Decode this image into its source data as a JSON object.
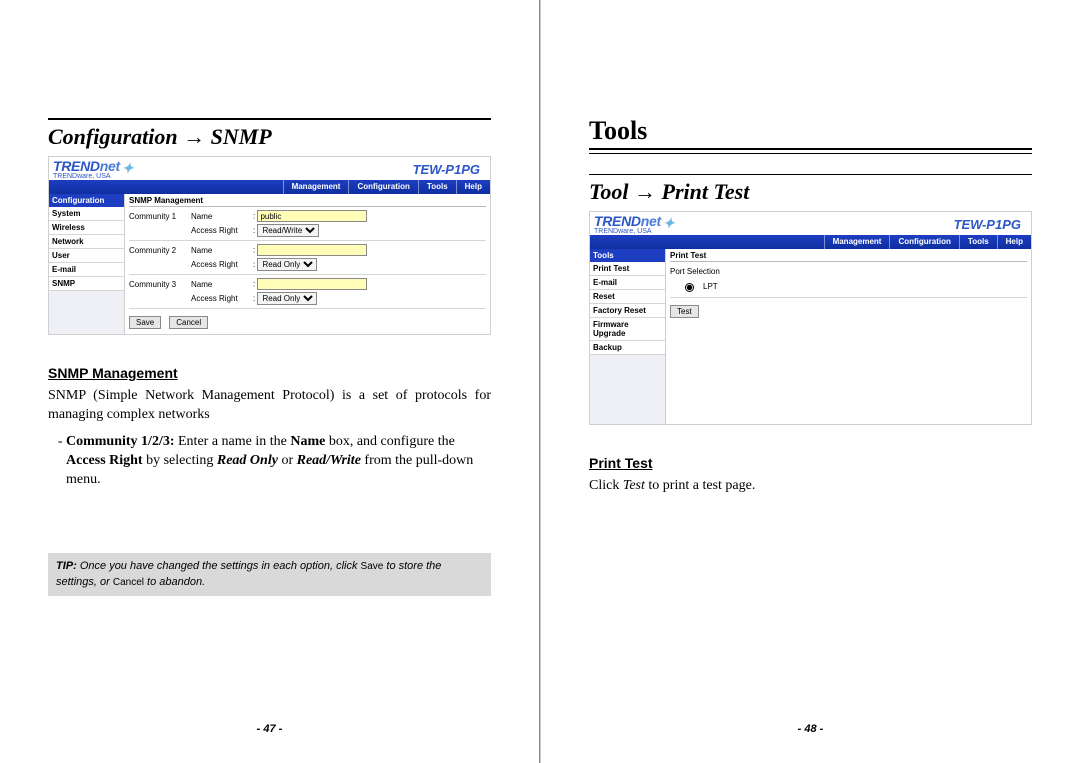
{
  "left": {
    "breadcrumb_prefix": "Configuration",
    "breadcrumb_arrow": " → ",
    "breadcrumb_target": "SNMP",
    "model": "TEW-P1PG",
    "brand_main": "TREND",
    "brand_suffix": "net",
    "brand_tagline": "TRENDware, USA",
    "nav": [
      "Management",
      "Configuration",
      "Tools",
      "Help"
    ],
    "sidebar_header": "Configuration",
    "sidebar_items": [
      "System",
      "Wireless",
      "Network",
      "User",
      "E-mail",
      "SNMP"
    ],
    "panel_title": "SNMP Management",
    "rows": [
      {
        "group": "Community 1",
        "name_label": "Name",
        "name_value": "public",
        "right_label": "Access Right",
        "right_value": "Read/Write"
      },
      {
        "group": "Community 2",
        "name_label": "Name",
        "name_value": "",
        "right_label": "Access Right",
        "right_value": "Read Only"
      },
      {
        "group": "Community 3",
        "name_label": "Name",
        "name_value": "",
        "right_label": "Access Right",
        "right_value": "Read Only"
      }
    ],
    "save_label": "Save",
    "cancel_label": "Cancel",
    "section_heading": "SNMP Management",
    "section_body": "SNMP (Simple Network Management Protocol) is a set of protocols for managing complex networks",
    "bullet_lead_bold": "Community 1/2/3: ",
    "bullet_text_1": "Enter a name in the ",
    "bullet_bold_name": "Name",
    "bullet_text_2": " box, and configure the ",
    "bullet_bold_access": "Access Right",
    "bullet_text_3": " by selecting ",
    "bullet_bi_ro": "Read Only",
    "bullet_text_4": " or ",
    "bullet_bi_rw": "Read/Write",
    "bullet_text_5": " from the pull-down menu.",
    "tip_label": "TIP: ",
    "tip_body_1": "Once you have changed the settings in each option, click ",
    "tip_save": "Save",
    "tip_body_2": " to store the settings, or ",
    "tip_cancel": "Cancel",
    "tip_body_3": " to abandon.",
    "page_num": "- 47 -"
  },
  "right": {
    "chapter_title": "Tools",
    "breadcrumb_prefix": "Tool",
    "breadcrumb_arrow": " → ",
    "breadcrumb_target": "Print Test",
    "model": "TEW-P1PG",
    "brand_main": "TREND",
    "brand_suffix": "net",
    "brand_tagline": "TRENDware, USA",
    "nav": [
      "Management",
      "Configuration",
      "Tools",
      "Help"
    ],
    "sidebar_header": "Tools",
    "sidebar_items": [
      "Print Test",
      "E-mail",
      "Reset",
      "Factory Reset",
      "Firmware Upgrade",
      "Backup"
    ],
    "panel_title": "Print Test",
    "port_selection_label": "Port Selection",
    "port_option": "LPT",
    "test_button": "Test",
    "section_heading": "Print Test",
    "section_body_1": "Click ",
    "section_body_ital": "Test",
    "section_body_2": " to print a test page.",
    "page_num": "- 48 -"
  }
}
